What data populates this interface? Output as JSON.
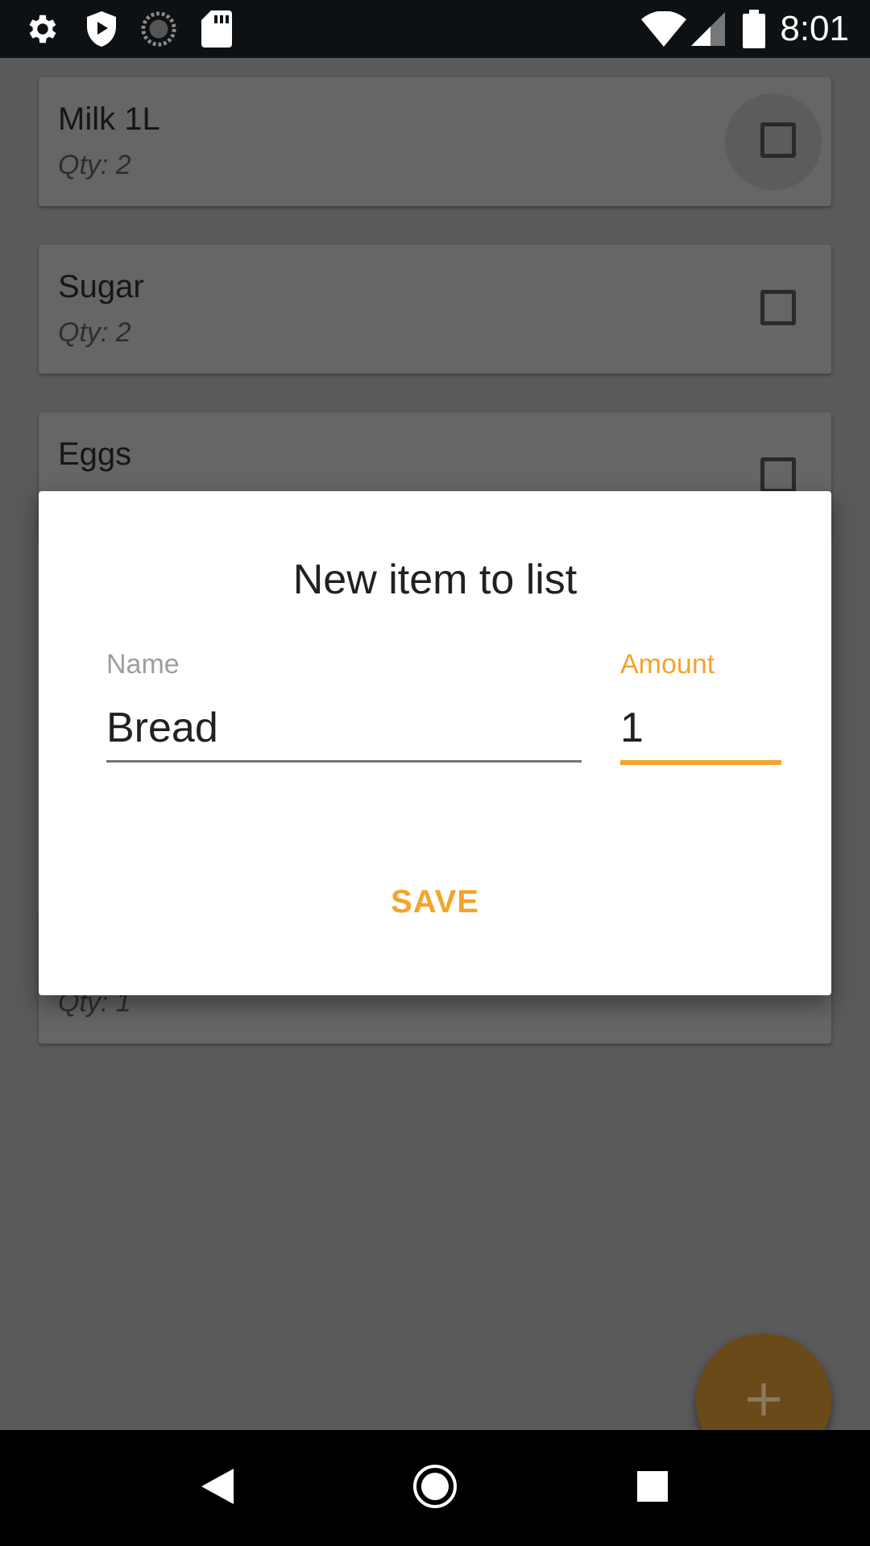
{
  "status_bar": {
    "time": "8:01",
    "icons": [
      "settings-icon",
      "shield-play-icon",
      "sync-icon",
      "sd-card-icon",
      "wifi-icon",
      "cellular-signal-icon",
      "battery-icon"
    ]
  },
  "list": {
    "items": [
      {
        "name": "Milk 1L",
        "qty": "Qty: 2",
        "checked": false
      },
      {
        "name": "Sugar",
        "qty": "Qty: 2",
        "checked": false
      },
      {
        "name": "Eggs",
        "qty": "",
        "checked": false
      },
      {
        "name": "",
        "qty": "Qty: 1",
        "checked": false
      }
    ]
  },
  "dialog": {
    "title": "New item to list",
    "name_label": "Name",
    "name_value": "Bread",
    "amount_label": "Amount",
    "amount_value": "1",
    "save_label": "SAVE"
  },
  "fab": {
    "icon": "plus-icon"
  },
  "nav_bar": {
    "icons": [
      "back-icon",
      "home-icon",
      "recents-icon"
    ]
  },
  "colors": {
    "accent": "#f4a42b",
    "status_bar": "#0d1114",
    "scrim_background": "#595959"
  }
}
